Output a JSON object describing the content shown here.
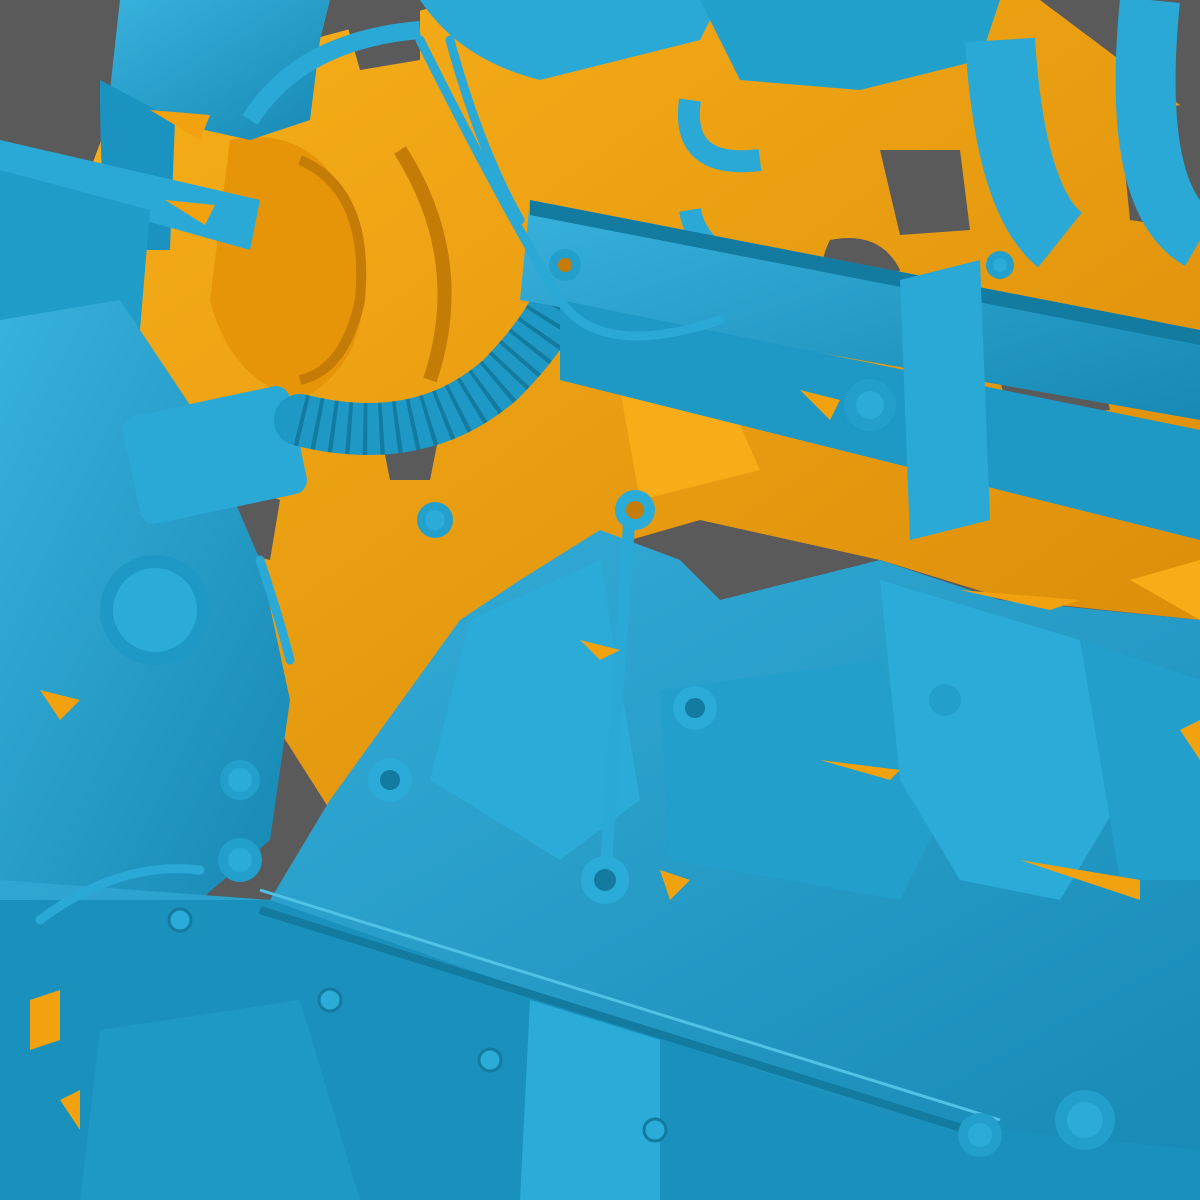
{
  "scene": {
    "colors": {
      "background": "#5a5a5a",
      "reference_mesh": "#f2a20f",
      "scan_mesh": "#1fa0cc",
      "scan_shadow": "#137aa0",
      "scan_highlight": "#4fc2e6",
      "reference_shadow": "#c47c06"
    }
  }
}
